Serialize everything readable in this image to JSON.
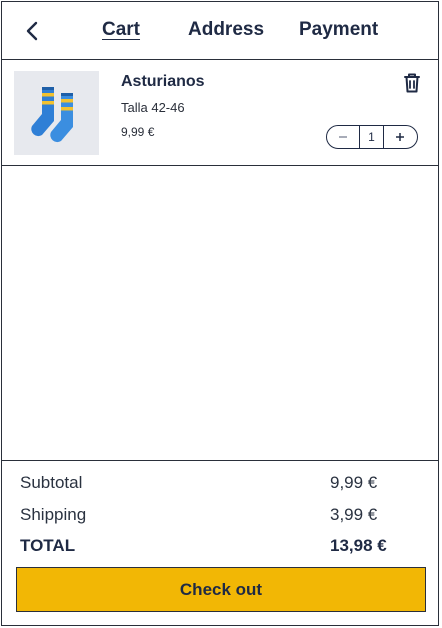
{
  "header": {
    "tabs": [
      {
        "label": "Cart",
        "active": true
      },
      {
        "label": "Address",
        "active": false
      },
      {
        "label": "Payment",
        "active": false
      }
    ]
  },
  "cart": {
    "items": [
      {
        "name": "Asturianos",
        "variant": "Talla 42-46",
        "price": "9,99 €",
        "quantity": "1",
        "image_icon": "socks-icon"
      }
    ]
  },
  "summary": {
    "subtotal_label": "Subtotal",
    "subtotal_value": "9,99 €",
    "shipping_label": "Shipping",
    "shipping_value": "3,99 €",
    "total_label": "TOTAL",
    "total_value": "13,98 €",
    "checkout_label": "Check out"
  },
  "colors": {
    "accent": "#f2b705",
    "text": "#1f2a44",
    "sock_blue": "#2f7fd6",
    "sock_stripe": "#f2c230"
  }
}
